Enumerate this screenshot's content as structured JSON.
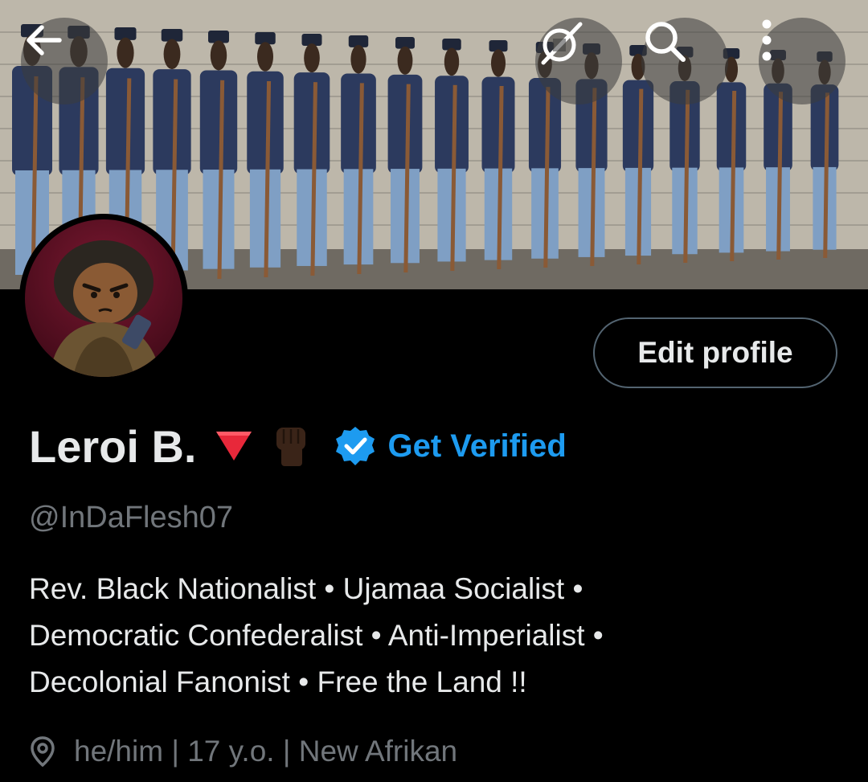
{
  "header": {
    "back_icon": "arrow-left-icon",
    "grok_icon": "grok-icon",
    "search_icon": "search-icon",
    "more_icon": "more-vertical-icon"
  },
  "banner": {
    "image": "banner-photo"
  },
  "profile": {
    "avatar": "avatar-image",
    "edit_button_label": "Edit profile",
    "name": "Leroi B.",
    "name_emojis": [
      "red-triangle-emoji",
      "raised-fist-emoji"
    ],
    "verified_badge_icon": "verified-badge-icon",
    "get_verified_label": "Get Verified",
    "handle": "@InDaFlesh07",
    "bio_lines": [
      "Rev. Black Nationalist • Ujamaa Socialist •",
      "Democratic Confederalist • Anti-Imperialist •",
      "Decolonial Fanonist • Free the Land !!"
    ],
    "location_icon": "location-pin-icon",
    "location": "he/him | 17 y.o. | New Afrikan"
  },
  "colors": {
    "background": "#000000",
    "text": "#e7e9ea",
    "secondary_text": "#71767b",
    "accent": "#1d9bf0",
    "button_border": "#536471"
  }
}
